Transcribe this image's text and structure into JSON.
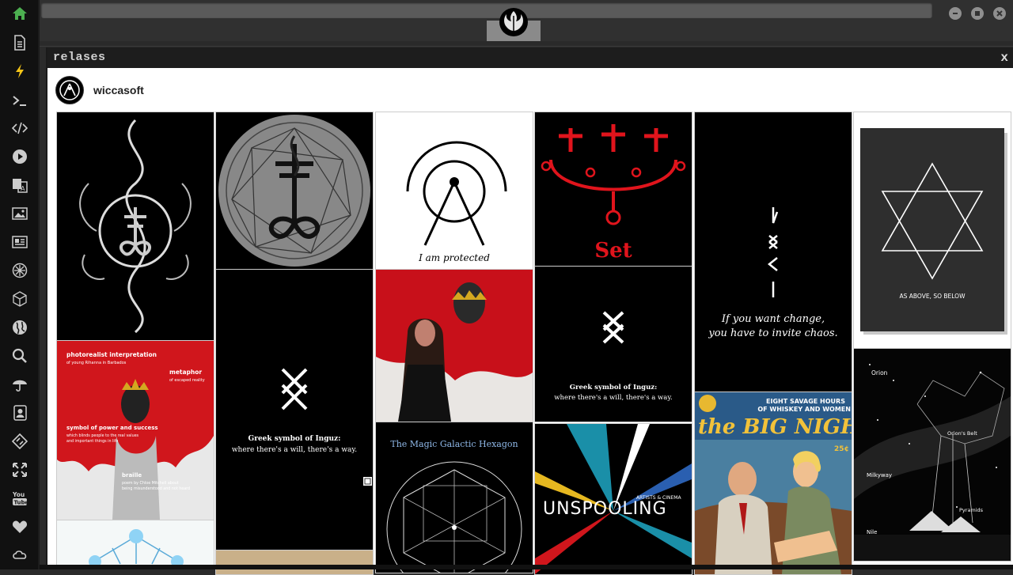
{
  "window": {
    "title": "relases",
    "close_label": "x"
  },
  "profile": {
    "name": "wiccasoft"
  },
  "sidebar": {
    "items": [
      {
        "icon": "home-icon"
      },
      {
        "icon": "document-icon"
      },
      {
        "icon": "lightning-icon"
      },
      {
        "icon": "terminal-icon"
      },
      {
        "icon": "code-icon"
      },
      {
        "icon": "play-icon"
      },
      {
        "icon": "translate-icon"
      },
      {
        "icon": "image-icon"
      },
      {
        "icon": "news-icon"
      },
      {
        "icon": "emblem-icon"
      },
      {
        "icon": "cube-icon"
      },
      {
        "icon": "globe-icon"
      },
      {
        "icon": "search-icon"
      },
      {
        "icon": "umbrella-icon"
      },
      {
        "icon": "contacts-icon"
      },
      {
        "icon": "tag-icon"
      },
      {
        "icon": "expand-icon"
      },
      {
        "icon": "youtube-icon"
      },
      {
        "icon": "heart-icon"
      },
      {
        "icon": "cloud-icon"
      }
    ]
  },
  "youtube_text": "You Tube",
  "posts": {
    "protected": "I am protected",
    "set": "Set",
    "inguz1_line1": "Greek symbol of Inguz:",
    "inguz1_line2": "where there's a will, there's a way.",
    "inguz2_line1": "Greek symbol of Inguz:",
    "inguz2_line2": "where there's a will, there's a way.",
    "chaos_line1": "If you want change,",
    "chaos_line2": "you have to invite chaos.",
    "above": "AS ABOVE, SO BELOW",
    "anti_title": "photorealist interpretation",
    "anti_sub": "of young Rihanna in Barbados",
    "anti_metaphor": "metaphor",
    "anti_metaphor_sub": "of escaped reality",
    "anti_power": "symbol of power and success",
    "anti_power_sub1": "which blinds people to the real values",
    "anti_power_sub2": "and important things in life",
    "anti_braille": "braille",
    "anti_braille_sub1": "poem by Chloe Mitchell about",
    "anti_braille_sub2": "being misunderstood and not heard",
    "hexagon": "The Magic Galactic Hexagon",
    "unspooling": "UNSPOOLING",
    "unspooling_sub": "ARTISTS & CINEMA",
    "bignight_top1": "EIGHT SAVAGE HOURS",
    "bignight_top2": "OF WHISKEY AND WOMEN!",
    "bignight_title": "the BIG NIGHT",
    "bignight_price": "25¢",
    "orion": "Orion",
    "orion_belt": "Orion's Belt",
    "milkyway": "Milkyway",
    "pyramids": "Pyramids",
    "nile": "Nile"
  }
}
